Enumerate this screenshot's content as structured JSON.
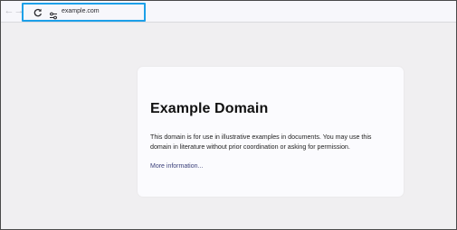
{
  "browser": {
    "url": "example.com"
  },
  "page": {
    "title": "Example Domain",
    "paragraph": "This domain is for use in illustrative examples in documents. You may use this domain in literature without prior coordination or asking for permission.",
    "link": "More information..."
  },
  "colors": {
    "highlight": "#1da0e8",
    "link": "#3a3f7a",
    "background": "#f0eff1",
    "card": "#fbfbfe"
  },
  "icons": [
    "back-arrow-icon",
    "forward-arrow-icon",
    "reload-icon",
    "site-settings-icon"
  ]
}
